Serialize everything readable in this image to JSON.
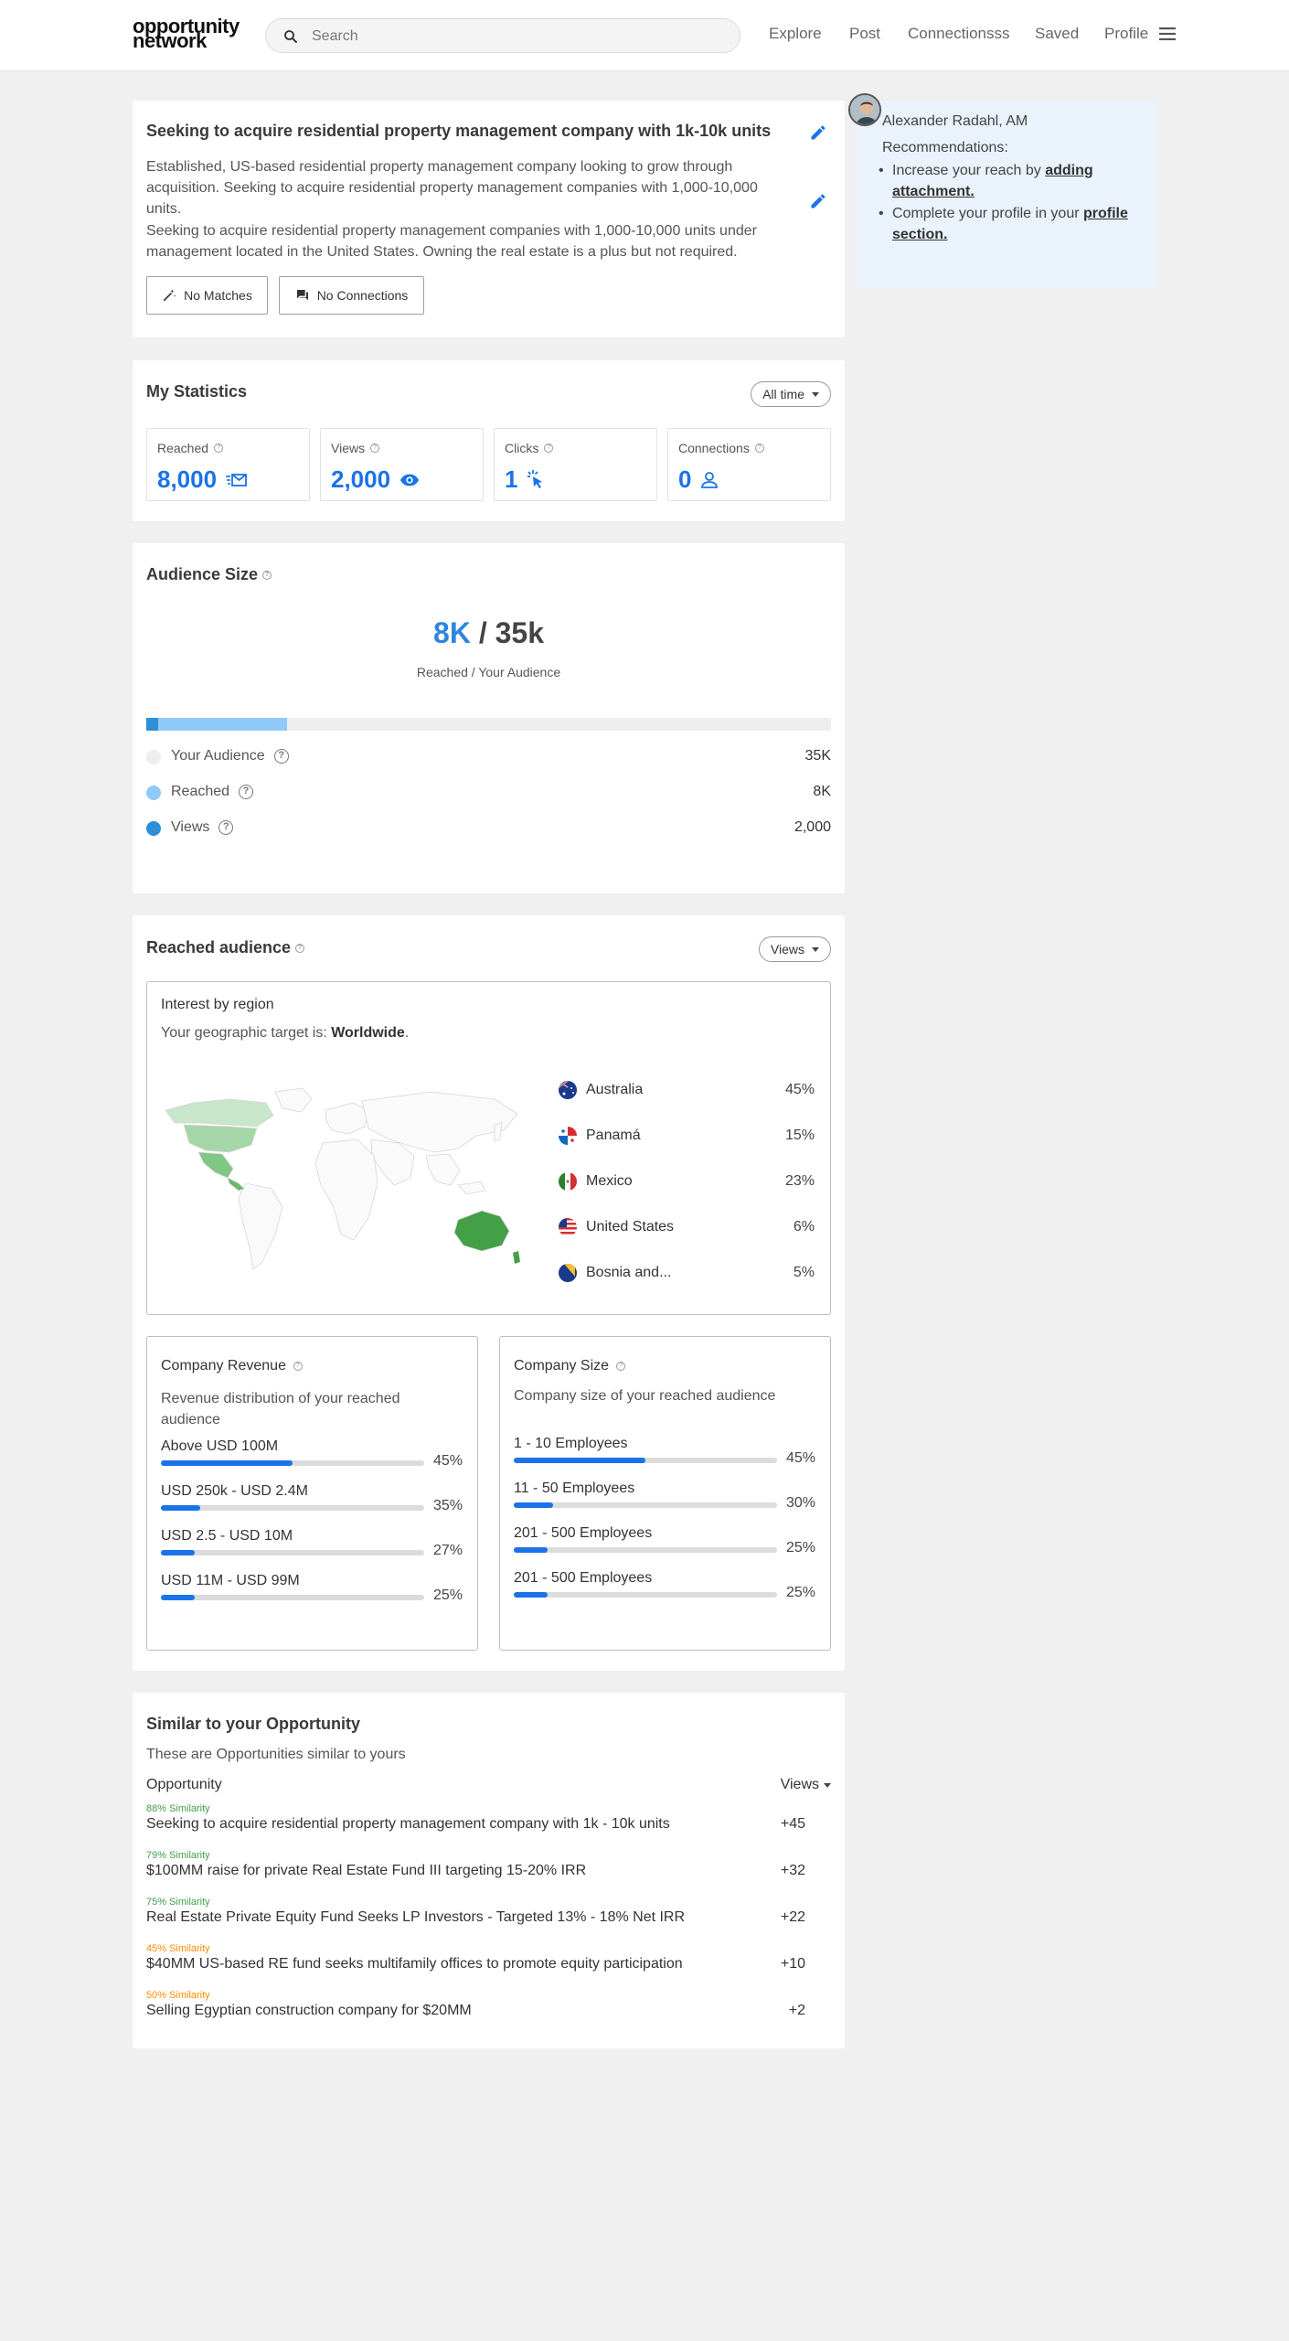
{
  "header": {
    "logo_line1": "opportunity",
    "logo_line2": "network",
    "search_placeholder": "Search",
    "nav": [
      "Explore",
      "Post",
      "Connectionsss",
      "Saved",
      "Profile"
    ]
  },
  "opportunity": {
    "title": "Seeking to acquire residential property management company with 1k-10k units",
    "description_1": "Established, US-based residential property management company looking to grow through acquisition. Seeking to acquire residential property management companies with 1,000-10,000 units.",
    "description_2": "Seeking to acquire residential property management companies with 1,000-10,000 units under management located in the United States. Owning the real estate is a plus but not required.",
    "matches_label": "No Matches",
    "connections_label": "No Connections"
  },
  "statistics": {
    "title": "My Statistics",
    "period": "All time",
    "items": [
      {
        "label": "Reached",
        "value": "8,000"
      },
      {
        "label": "Views",
        "value": "2,000"
      },
      {
        "label": "Clicks",
        "value": "1"
      },
      {
        "label": "Connections",
        "value": "0"
      }
    ]
  },
  "audience": {
    "title": "Audience Size",
    "reached": "8K",
    "separator": "/",
    "total": "35k",
    "caption": "Reached / Your Audience",
    "reached_fraction": 0.206,
    "views_fraction": 0.018,
    "legend": [
      {
        "label": "Your Audience",
        "value": "35K",
        "color": "#eeeeee"
      },
      {
        "label": "Reached",
        "value": "8K",
        "color": "#90caf9"
      },
      {
        "label": "Views",
        "value": "2,000",
        "color": "#2c8fd8"
      }
    ]
  },
  "reached_audience": {
    "title": "Reached audience",
    "filter": "Views",
    "region_title": "Interest by region",
    "target_prefix": "Your geographic target is: ",
    "target_value": "Worldwide",
    "target_suffix": ".",
    "regions": [
      {
        "name": "Australia",
        "pct": "45%"
      },
      {
        "name": "Panamá",
        "pct": "15%"
      },
      {
        "name": "Mexico",
        "pct": "23%"
      },
      {
        "name": "United States",
        "pct": "6%"
      },
      {
        "name": "Bosnia and...",
        "pct": "5%"
      }
    ],
    "revenue": {
      "title": "Company Revenue",
      "subtitle": "Revenue distribution of your reached audience",
      "rows": [
        {
          "label": "Above USD 100M",
          "pct": "45%",
          "fraction": 0.5
        },
        {
          "label": "USD 250k - USD 2.4M",
          "pct": "35%",
          "fraction": 0.15
        },
        {
          "label": "USD 2.5 - USD 10M",
          "pct": "27%",
          "fraction": 0.13
        },
        {
          "label": "USD 11M - USD 99M",
          "pct": "25%",
          "fraction": 0.13
        }
      ]
    },
    "size": {
      "title": "Company Size",
      "subtitle": "Company size of your reached audience",
      "rows": [
        {
          "label": "1 - 10  Employees",
          "pct": "45%",
          "fraction": 0.5
        },
        {
          "label": "11 - 50 Employees",
          "pct": "30%",
          "fraction": 0.15
        },
        {
          "label": "201 - 500 Employees",
          "pct": "25%",
          "fraction": 0.13
        },
        {
          "label": "201 - 500 Employees",
          "pct": "25%",
          "fraction": 0.13
        }
      ]
    }
  },
  "similar": {
    "title": "Similar to your Opportunity",
    "subtitle": "These are Opportunities similar to yours",
    "col_opportunity": "Opportunity",
    "col_views": "Views",
    "rows": [
      {
        "similarity": "88% Similarity",
        "title": "Seeking to acquire residential property management company with 1k - 10k units",
        "views": "+45",
        "color": "#43a047"
      },
      {
        "similarity": "79% Similarity",
        "title": "$100MM raise for private Real Estate Fund III targeting 15-20% IRR",
        "views": "+32",
        "color": "#43a047"
      },
      {
        "similarity": "75% Similarity",
        "title": "Real Estate Private Equity Fund Seeks LP Investors - Targeted 13% - 18% Net IRR",
        "views": "+22",
        "color": "#43a047"
      },
      {
        "similarity": "45% Similarity",
        "title": "$40MM US-based RE fund seeks multifamily offices to promote equity participation",
        "views": "+10",
        "color": "#fb8c00"
      },
      {
        "similarity": "50% Similarity",
        "title": "Selling Egyptian construction company for $20MM",
        "views": "+2",
        "color": "#fb8c00"
      }
    ]
  },
  "recommendations": {
    "name": "Alexander Radahl, AM",
    "heading": "Recommendations:",
    "item1_prefix": "Increase your reach by ",
    "item1_link": "adding attachment.",
    "item2_prefix": "Complete your profile in your ",
    "item2_link": "profile section."
  }
}
